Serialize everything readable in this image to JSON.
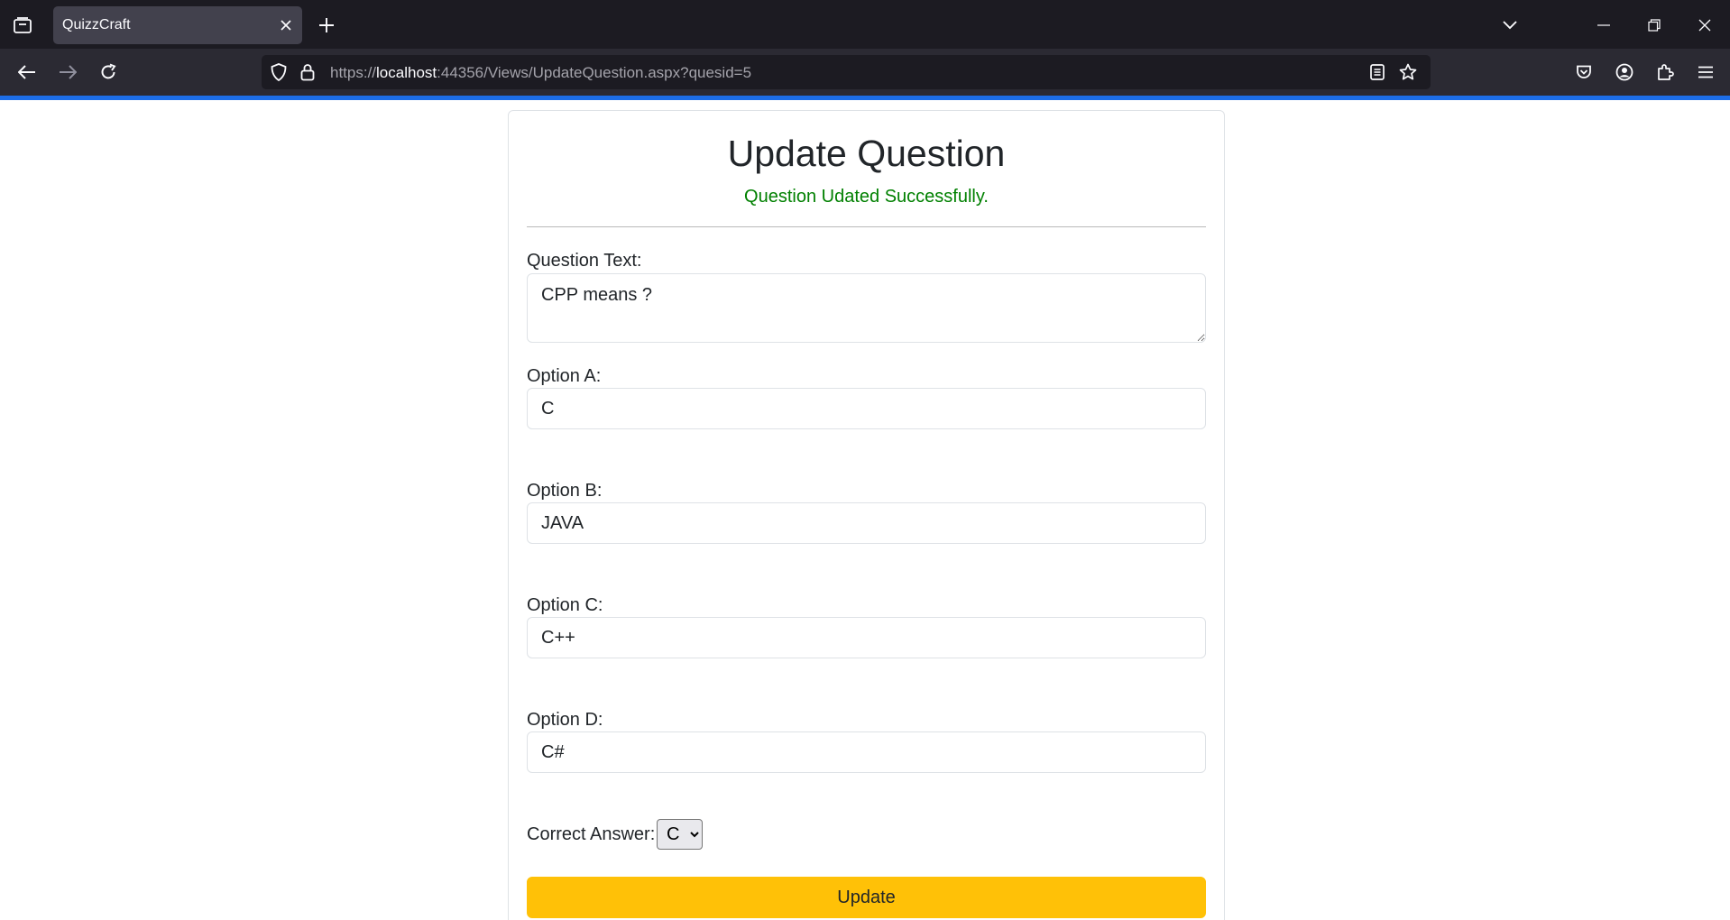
{
  "browser": {
    "tab_title": "QuizzCraft",
    "url_prefix": "https://",
    "url_host": "localhost",
    "url_rest": ":44356/Views/UpdateQuestion.aspx?quesid=5",
    "accent_color": "#1d6ee8"
  },
  "page": {
    "title": "Update Question",
    "status_message": "Question Udated Successfully.",
    "status_color": "#008000"
  },
  "form": {
    "question_label": "Question Text:",
    "question_value": "CPP means ?",
    "option_a_label": "Option A:",
    "option_a_value": "C",
    "option_b_label": "Option B:",
    "option_b_value": "JAVA",
    "option_c_label": "Option C:",
    "option_c_value": "C++",
    "option_d_label": "Option D:",
    "option_d_value": "C#",
    "correct_answer_label": "Correct Answer:",
    "correct_answer_value": "C",
    "update_button_label": "Update",
    "button_color": "#ffc107"
  }
}
